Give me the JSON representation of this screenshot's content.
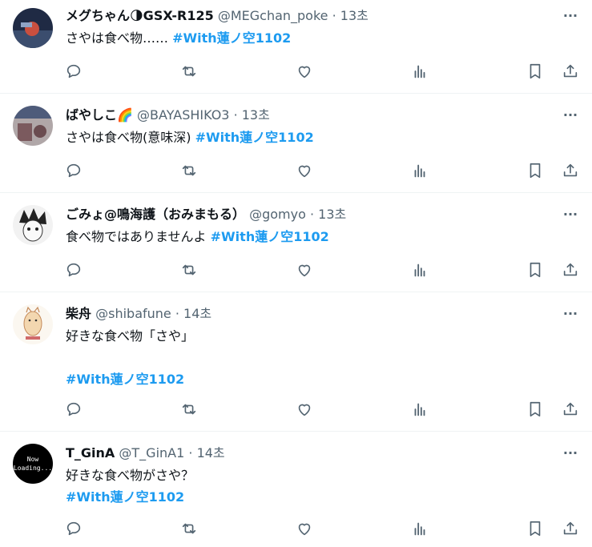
{
  "tweets": [
    {
      "name": "メグちゃん🌗GSX-R125",
      "handle": "@MEGchan_poke",
      "sep": " · ",
      "time": "13초",
      "text_lines": [
        "さやは食べ物……"
      ],
      "hashtag": "#With蓮ノ空1102",
      "hashtag_inline": true,
      "avatar_color": "#2b3a57"
    },
    {
      "name": "ばやしこ🌈",
      "handle": "@BAYASHIKO3",
      "sep": " · ",
      "time": "13초",
      "text_lines": [
        "さやは食べ物(意味深)"
      ],
      "hashtag": "#With蓮ノ空1102",
      "hashtag_inline": true,
      "avatar_color": "#8a7a7c"
    },
    {
      "name": "ごみょ@鳴海護（おみまもる）",
      "handle": "@gomyo",
      "sep": " · ",
      "time": "13초",
      "text_lines": [
        "食べ物ではありませんよ"
      ],
      "hashtag": "#With蓮ノ空1102",
      "hashtag_inline": true,
      "avatar_color": "#e8e8e8"
    },
    {
      "name": "柴舟",
      "handle": "@shibafune",
      "sep": " · ",
      "time": "14초",
      "text_lines": [
        "好きな食べ物「さや」",
        ""
      ],
      "hashtag": "#With蓮ノ空1102",
      "hashtag_inline": false,
      "avatar_color": "#f5efe6"
    },
    {
      "name": "T_GinA",
      "handle": "@T_GinA1",
      "sep": " · ",
      "time": "14초",
      "text_lines": [
        "好きな食べ物がさや？"
      ],
      "hashtag": "#With蓮ノ空1102",
      "hashtag_inline": false,
      "avatar_text": "Now Loading...",
      "avatar_color": "#000000"
    }
  ],
  "icons": {
    "more": "more-icon",
    "reply": "reply-icon",
    "retweet": "retweet-icon",
    "like": "like-icon",
    "views": "views-icon",
    "bookmark": "bookmark-icon",
    "share": "share-icon"
  },
  "colors": {
    "hashtag": "#1d9bf0",
    "secondary": "#536471",
    "border": "#eff3f4"
  }
}
